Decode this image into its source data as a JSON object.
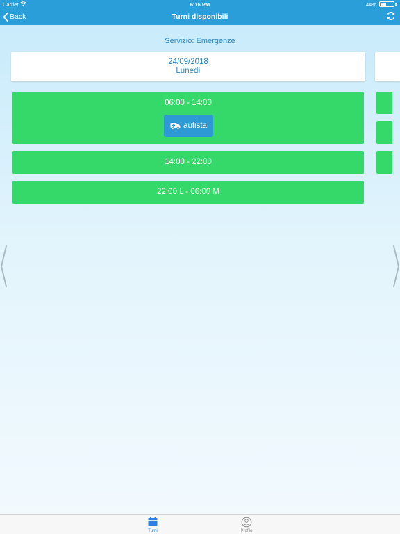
{
  "status_bar": {
    "carrier": "Carrier",
    "time": "6:16 PM",
    "battery_percent": "44%",
    "battery_level": 0.44
  },
  "nav": {
    "back_label": "Back",
    "title": "Turni disponibili",
    "refresh_icon": "refresh-icon"
  },
  "service": {
    "title": "Servizio: Emergenze"
  },
  "day": {
    "date": "24/09/2018",
    "weekday": "Lunedì"
  },
  "shifts": [
    {
      "time": "06:00 - 14:00",
      "role": "autista",
      "role_icon": "ambulance-icon"
    },
    {
      "time": "14:00 - 22:00"
    },
    {
      "time": "22:00 L - 06:00 M"
    }
  ],
  "tab_bar": {
    "items": [
      {
        "label": "Turni",
        "icon": "calendar-icon",
        "active": true
      },
      {
        "label": "Profilo",
        "icon": "profile-icon",
        "active": false
      }
    ]
  },
  "colors": {
    "header": "#2a9ed9",
    "shift_available": "#35d96a",
    "role_button": "#2d9ad6",
    "accent_text": "#2a87c0",
    "tab_active": "#2d7fe0"
  }
}
